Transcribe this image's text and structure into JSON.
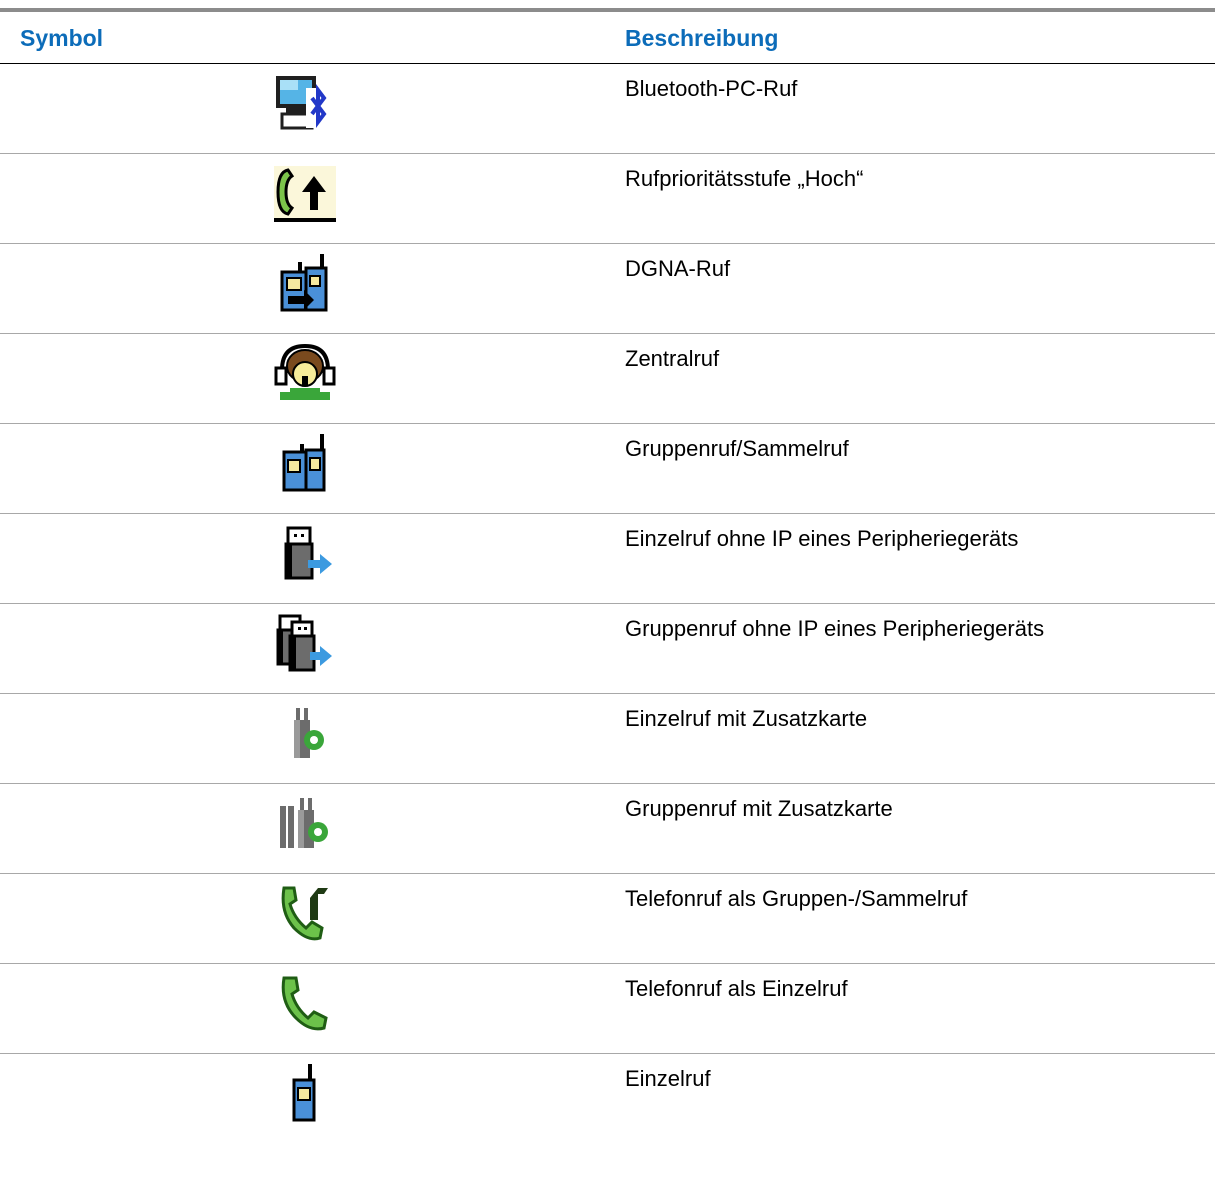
{
  "table": {
    "header": {
      "symbol": "Symbol",
      "description": "Beschreibung"
    },
    "rows": [
      {
        "icon": "bluetooth-pc-call-icon",
        "description": "Bluetooth-PC-Ruf"
      },
      {
        "icon": "call-priority-high-icon",
        "description": "Rufprioritätsstufe „Hoch“"
      },
      {
        "icon": "dgna-call-icon",
        "description": "DGNA-Ruf"
      },
      {
        "icon": "dispatcher-call-icon",
        "description": "Zentralruf"
      },
      {
        "icon": "group-call-icon",
        "description": "Gruppenruf/Sammelruf"
      },
      {
        "icon": "non-ip-peripheral-private-call-icon",
        "description": "Einzelruf ohne IP eines Peripheriegeräts"
      },
      {
        "icon": "non-ip-peripheral-group-call-icon",
        "description": "Gruppenruf ohne IP eines Peripheriegeräts"
      },
      {
        "icon": "option-board-private-call-icon",
        "description": "Einzelruf mit Zusatzkarte"
      },
      {
        "icon": "option-board-group-call-icon",
        "description": "Gruppenruf mit Zusatzkarte"
      },
      {
        "icon": "phone-group-call-icon",
        "description": "Telefonruf als Gruppen-/Sammelruf"
      },
      {
        "icon": "phone-private-call-icon",
        "description": "Telefonruf als Einzelruf"
      },
      {
        "icon": "private-call-icon",
        "description": "Einzelruf"
      }
    ]
  },
  "colors": {
    "header_text": "#0c6cb9",
    "top_rule": "#8c8c8c",
    "row_divider": "#a8a8a8"
  }
}
